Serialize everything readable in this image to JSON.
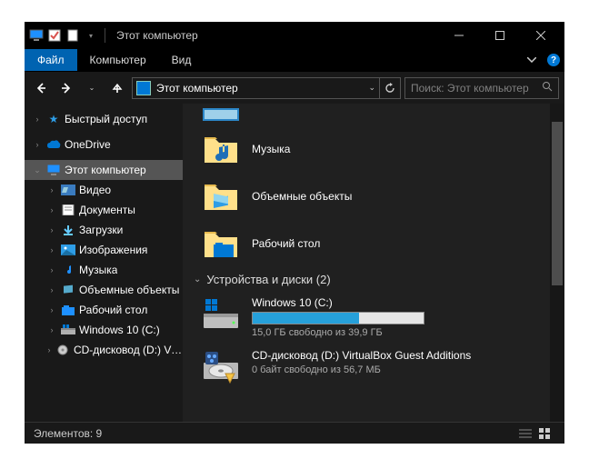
{
  "window": {
    "title": "Этот компьютер"
  },
  "ribbon": {
    "file": "Файл",
    "computer": "Компьютер",
    "view": "Вид"
  },
  "address": {
    "location": "Этот компьютер"
  },
  "search": {
    "placeholder": "Поиск: Этот компьютер"
  },
  "sidebar": {
    "quick_access": "Быстрый доступ",
    "onedrive": "OneDrive",
    "this_pc": "Этот компьютер",
    "items": [
      "Видео",
      "Документы",
      "Загрузки",
      "Изображения",
      "Музыка",
      "Объемные объекты",
      "Рабочий стол",
      "Windows 10 (C:)",
      "CD-дисковод (D:) VirtualBox Guest Additions"
    ]
  },
  "content": {
    "folders": [
      "Музыка",
      "Объемные объекты",
      "Рабочий стол"
    ],
    "section_label": "Устройства и диски (2)",
    "drives": [
      {
        "name": "Windows 10 (C:)",
        "free_text": "15,0 ГБ свободно из 39,9 ГБ",
        "fill_percent": 62
      },
      {
        "name": "CD-дисковод (D:) VirtualBox Guest Additions",
        "free_text": "0 байт свободно из 56,7 МБ"
      }
    ]
  },
  "status": {
    "items": "Элементов: 9"
  }
}
